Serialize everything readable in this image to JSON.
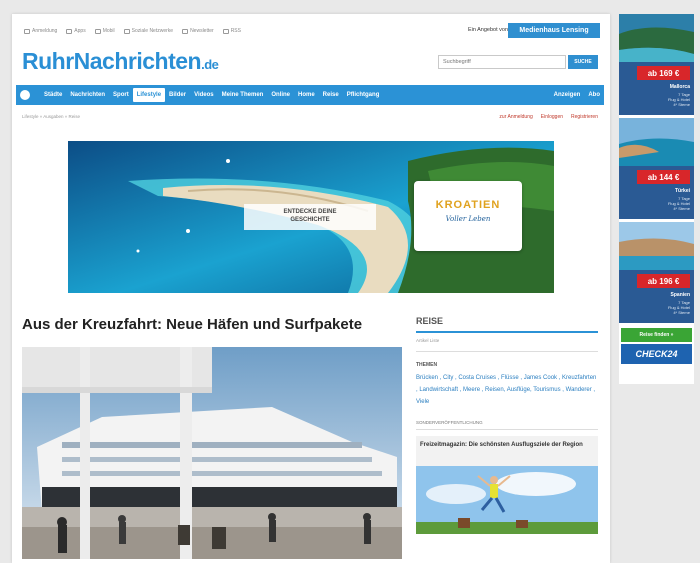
{
  "utility_bar": {
    "items": [
      {
        "label": "Anmeldung",
        "icon": "user-icon"
      },
      {
        "label": "Apps",
        "icon": "apps-icon"
      },
      {
        "label": "Mobil",
        "icon": "mobile-icon"
      },
      {
        "label": "Soziale Netzwerke",
        "icon": "share-icon"
      },
      {
        "label": "Newsletter",
        "icon": "mail-icon"
      },
      {
        "label": "RSS",
        "icon": "rss-icon"
      }
    ],
    "supported_by": "Ein Angebot von",
    "medienhaus": "Medienhaus Lensing"
  },
  "logo": {
    "name": "RuhrNachrichten",
    "tld": ".de"
  },
  "search": {
    "placeholder": "Suchbegriff",
    "button": "SUCHE"
  },
  "nav": {
    "items": [
      "Städte",
      "Nachrichten",
      "Sport",
      "Lifestyle",
      "Bilder",
      "Videos",
      "Meine Themen",
      "Online",
      "Home",
      "Reise",
      "Pflichtgang"
    ],
    "active_index": 3,
    "right_items": [
      "Anzeigen",
      "Abo"
    ]
  },
  "breadcrumb": "Lifestyle » Ausgaben » Reise",
  "crumb_right": [
    "zur Anmeldung",
    "Einloggen",
    "Registrieren"
  ],
  "banner": {
    "cta": "ENTDECKE DEINE\nGESCHICHTE",
    "brand": "KROATIEN",
    "tagline": "Voller Leben"
  },
  "article": {
    "headline": "Aus der Kreuzfahrt: Neue Häfen und Surfpakete"
  },
  "sidebar": {
    "section_title": "REISE",
    "section_sub": "Artikel Liste",
    "themen_label": "THEMEN",
    "tags": "Brücken , City , Costa Cruises , Flüsse , James Cook , Kreuzfahrten , Landwirtschaft , Meere , Reisen, Ausflüge, Tourismus , Wanderer , Viele",
    "sonder_label": "SONDERVERÖFFENTLICHUNG",
    "card_title": "Freizeitmagazin: Die schönsten Ausflugsziele der Region"
  },
  "ads": {
    "tiles": [
      {
        "price": "ab 169 €",
        "place": "Mallorca",
        "info": "7 Tage\nFlug & Hotel\n4* Sterne"
      },
      {
        "price": "ab 144 €",
        "place": "Türkei",
        "info": "7 Tage\nFlug & Hotel\n4* Sterne"
      },
      {
        "price": "ab 196 €",
        "place": "Spanien",
        "info": "7 Tage\nFlug & Hotel\n4* Sterne"
      }
    ],
    "cta": "Reise finden »",
    "brand": "CHECK24"
  },
  "colors": {
    "brand_blue": "#2b92d6",
    "price_red": "#d8262a",
    "check24_blue": "#1e63b0",
    "cta_green": "#3aa535"
  }
}
